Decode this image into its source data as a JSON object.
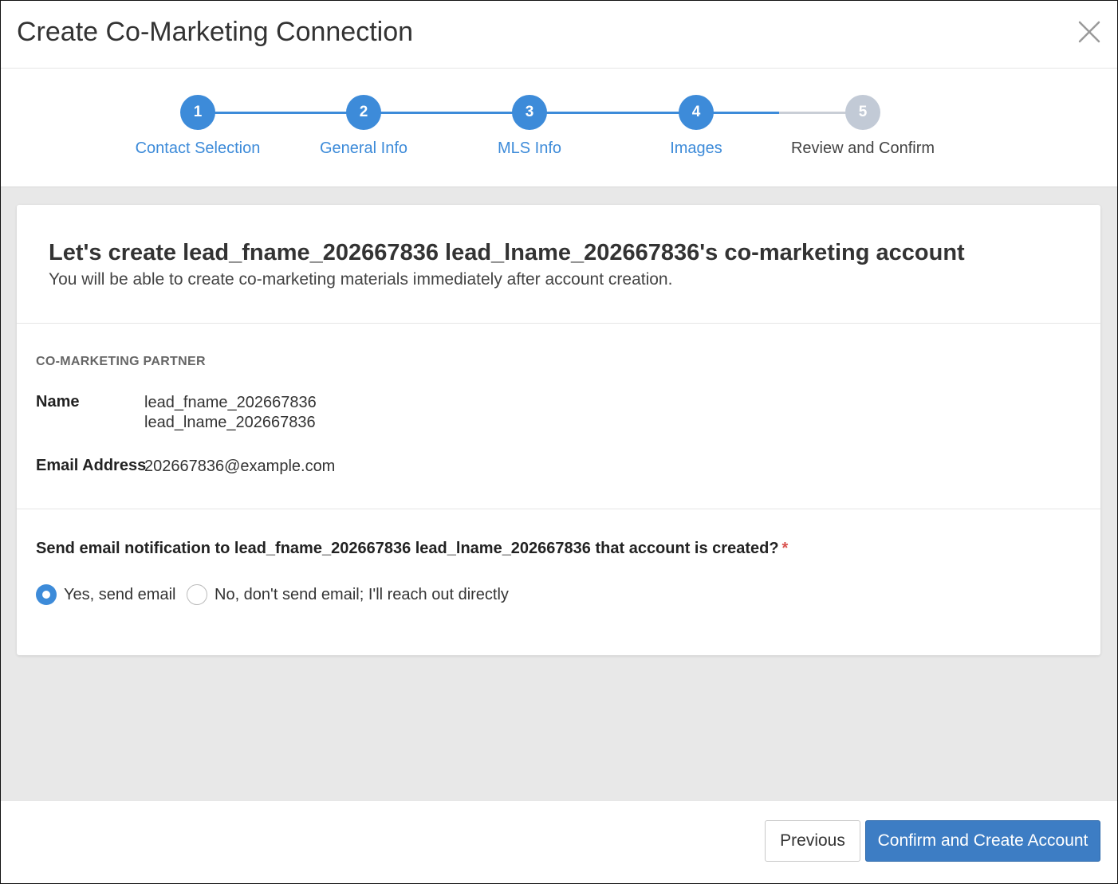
{
  "modal": {
    "title": "Create Co-Marketing Connection",
    "close_icon": "close-icon"
  },
  "stepper": {
    "active_color": "#3d8bd9",
    "inactive_color": "#c2cad6",
    "steps": [
      {
        "number": "1",
        "label": "Contact Selection",
        "state": "complete"
      },
      {
        "number": "2",
        "label": "General Info",
        "state": "complete"
      },
      {
        "number": "3",
        "label": "MLS Info",
        "state": "complete"
      },
      {
        "number": "4",
        "label": "Images",
        "state": "complete"
      },
      {
        "number": "5",
        "label": "Review and Confirm",
        "state": "current"
      }
    ]
  },
  "card": {
    "title": "Let's create lead_fname_202667836 lead_lname_202667836's co-marketing account",
    "subtitle": "You will be able to create co-marketing materials immediately after account creation."
  },
  "partner": {
    "section_label": "CO-MARKETING PARTNER",
    "name_label": "Name",
    "first_name": "lead_fname_202667836",
    "last_name": "lead_lname_202667836",
    "email_label": "Email Address",
    "email": "202667836@example.com"
  },
  "notification": {
    "question": "Send email notification to lead_fname_202667836 lead_lname_202667836 that account is created?",
    "required_mark": "*",
    "options": [
      {
        "label": "Yes, send email",
        "selected": true
      },
      {
        "label": "No, don't send email; I'll reach out directly",
        "selected": false
      }
    ]
  },
  "footer": {
    "previous_label": "Previous",
    "confirm_label": "Confirm and Create Account"
  }
}
